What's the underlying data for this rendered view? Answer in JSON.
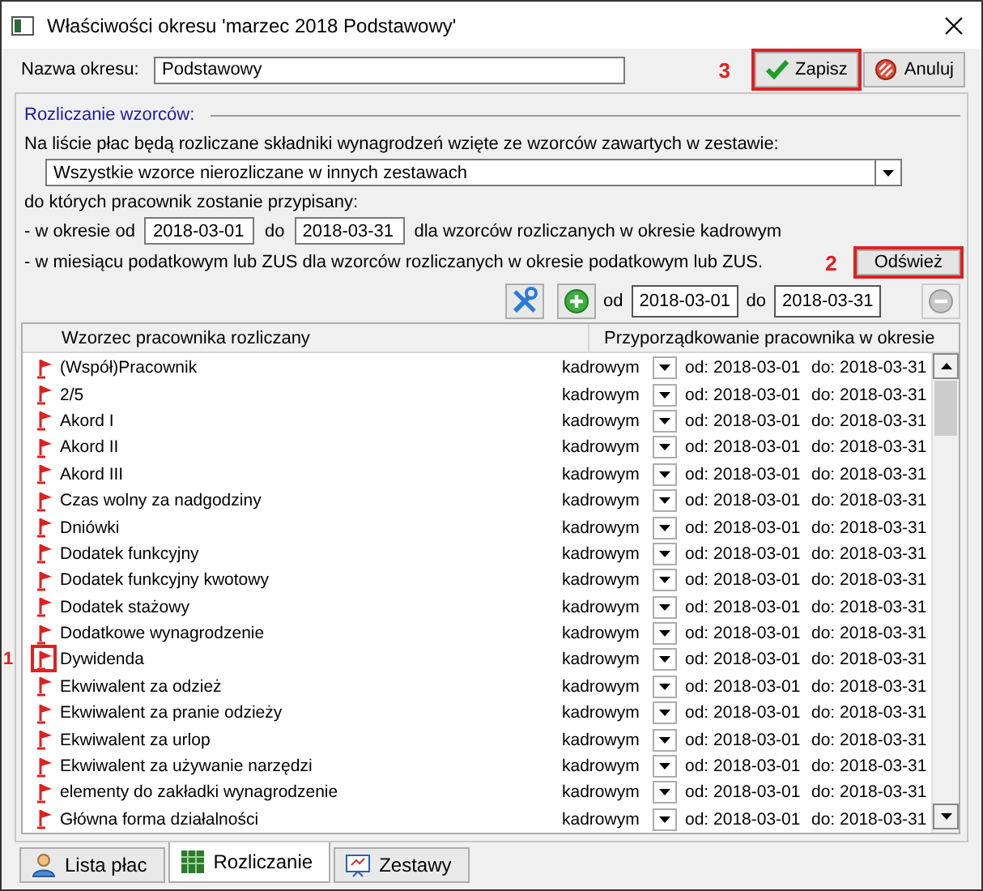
{
  "window": {
    "title": "Właściwości okresu 'marzec 2018 Podstawowy'"
  },
  "period_name": {
    "label": "Nazwa okresu:",
    "value": "Podstawowy"
  },
  "buttons": [
    {
      "kind": "save",
      "label": "Zapisz",
      "callout": "3"
    },
    {
      "kind": "cancel",
      "label": "Anuluj"
    }
  ],
  "section": {
    "title": "Rozliczanie wzorców:",
    "intro": "Na liście płac będą rozliczane składniki wynagrodzeń wzięte ze wzorców zawartych w zestawie:",
    "set_select": {
      "value": "Wszystkie wzorce nierozliczane w innych zestawach"
    },
    "assigned_text": "do których pracownik zostanie przypisany:",
    "period_line": {
      "prefix": "- w okresie od",
      "from": "2018-03-01",
      "mid": "do",
      "to": "2018-03-31",
      "suffix": "dla wzorców rozliczanych w okresie kadrowym"
    },
    "tax_line": "- w miesiącu podatkowym lub ZUS dla wzorców rozliczanych w okresie podatkowym lub ZUS.",
    "refresh_button": {
      "label": "Odśwież",
      "callout": "2"
    }
  },
  "toolbar": {
    "from_label": "od",
    "from": "2018-03-01",
    "to_label": "do",
    "to": "2018-03-31",
    "remove_disabled": true
  },
  "table": {
    "columns": [
      "Wzorzec pracownika rozliczany",
      "Przyporządkowanie pracownika w okresie"
    ],
    "rows": [
      {
        "name": "(Współ)Pracownik",
        "mode": "kadrowym",
        "from": "od: 2018-03-01",
        "to": "do: 2018-03-31"
      },
      {
        "name": "2/5",
        "mode": "kadrowym",
        "from": "od: 2018-03-01",
        "to": "do: 2018-03-31"
      },
      {
        "name": "Akord I",
        "mode": "kadrowym",
        "from": "od: 2018-03-01",
        "to": "do: 2018-03-31"
      },
      {
        "name": "Akord II",
        "mode": "kadrowym",
        "from": "od: 2018-03-01",
        "to": "do: 2018-03-31"
      },
      {
        "name": "Akord III",
        "mode": "kadrowym",
        "from": "od: 2018-03-01",
        "to": "do: 2018-03-31"
      },
      {
        "name": "Czas wolny za nadgodziny",
        "mode": "kadrowym",
        "from": "od: 2018-03-01",
        "to": "do: 2018-03-31"
      },
      {
        "name": "Dniówki",
        "mode": "kadrowym",
        "from": "od: 2018-03-01",
        "to": "do: 2018-03-31"
      },
      {
        "name": "Dodatek funkcyjny",
        "mode": "kadrowym",
        "from": "od: 2018-03-01",
        "to": "do: 2018-03-31"
      },
      {
        "name": "Dodatek funkcyjny kwotowy",
        "mode": "kadrowym",
        "from": "od: 2018-03-01",
        "to": "do: 2018-03-31"
      },
      {
        "name": "Dodatek stażowy",
        "mode": "kadrowym",
        "from": "od: 2018-03-01",
        "to": "do: 2018-03-31"
      },
      {
        "name": "Dodatkowe wynagrodzenie",
        "mode": "kadrowym",
        "from": "od: 2018-03-01",
        "to": "do: 2018-03-31"
      },
      {
        "name": "Dywidenda",
        "mode": "kadrowym",
        "from": "od: 2018-03-01",
        "to": "do: 2018-03-31",
        "callout": "1"
      },
      {
        "name": "Ekwiwalent za odzież",
        "mode": "kadrowym",
        "from": "od: 2018-03-01",
        "to": "do: 2018-03-31"
      },
      {
        "name": "Ekwiwalent za pranie odzieży",
        "mode": "kadrowym",
        "from": "od: 2018-03-01",
        "to": "do: 2018-03-31"
      },
      {
        "name": "Ekwiwalent za urlop",
        "mode": "kadrowym",
        "from": "od: 2018-03-01",
        "to": "do: 2018-03-31"
      },
      {
        "name": "Ekwiwalent za używanie narzędzi",
        "mode": "kadrowym",
        "from": "od: 2018-03-01",
        "to": "do: 2018-03-31"
      },
      {
        "name": "elementy do zakładki wynagrodzenie",
        "mode": "kadrowym",
        "from": "od: 2018-03-01",
        "to": "do: 2018-03-31"
      },
      {
        "name": "Główna forma działalności",
        "mode": "kadrowym",
        "from": "od: 2018-03-01",
        "to": "do: 2018-03-31"
      }
    ]
  },
  "tabs": [
    {
      "kind": "person",
      "label": "Lista płac",
      "selected": false
    },
    {
      "kind": "sheet",
      "label": "Rozliczanie",
      "selected": true
    },
    {
      "kind": "board",
      "label": "Zestawy",
      "selected": false
    }
  ]
}
